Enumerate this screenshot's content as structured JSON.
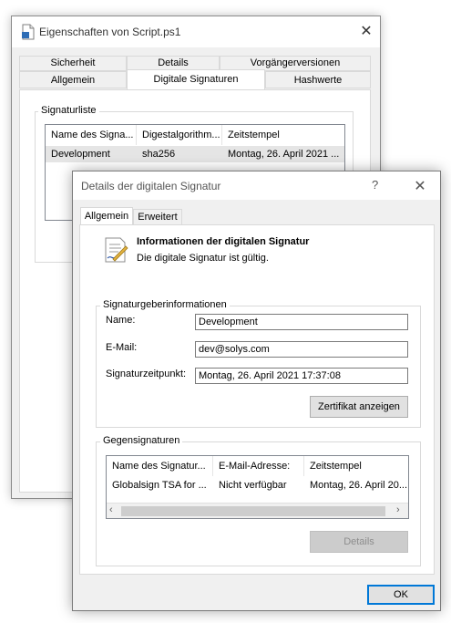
{
  "properties_window": {
    "title": "Eigenschaften von Script.ps1",
    "tabs_row1": [
      "Sicherheit",
      "Details",
      "Vorgängerversionen"
    ],
    "tabs_row2": [
      "Allgemein",
      "Digitale Signaturen",
      "Hashwerte"
    ],
    "active_tab": "Digitale Signaturen",
    "signature_list": {
      "label": "Signaturliste",
      "columns": [
        "Name des Signa...",
        "Digestalgorithm...",
        "Zeitstempel"
      ],
      "rows": [
        [
          "Development",
          "sha256",
          "Montag, 26. April 2021 ..."
        ]
      ]
    }
  },
  "details_dialog": {
    "title": "Details der digitalen Signatur",
    "help": "?",
    "close": "✕",
    "tabs": [
      "Allgemein",
      "Erweitert"
    ],
    "active_tab": "Allgemein",
    "info_heading": "Informationen der digitalen Signatur",
    "info_status": "Die digitale Signatur ist gültig.",
    "signer": {
      "label": "Signaturgeberinformationen",
      "name_label": "Name:",
      "name_value": "Development",
      "email_label": "E-Mail:",
      "email_value": "dev@solys.com",
      "time_label": "Signaturzeitpunkt:",
      "time_value": "Montag, 26. April 2021 17:37:08",
      "view_cert_button": "Zertifikat anzeigen"
    },
    "countersignatures": {
      "label": "Gegensignaturen",
      "columns": [
        "Name des Signatur...",
        "E-Mail-Adresse:",
        "Zeitstempel"
      ],
      "rows": [
        [
          "Globalsign TSA for ...",
          "Nicht verfügbar",
          "Montag, 26. April 20..."
        ]
      ],
      "details_button": "Details"
    },
    "ok_button": "OK"
  },
  "icons": {
    "window_icon": "document-script-icon",
    "info_icon": "signed-certificate-icon"
  }
}
